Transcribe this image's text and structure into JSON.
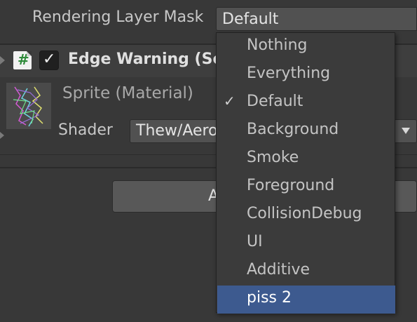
{
  "rendering_layer_mask": {
    "label": "Rendering Layer Mask",
    "value": "Default"
  },
  "component": {
    "title": "Edge Warning (Scr",
    "icon": "script-icon",
    "enabled": true
  },
  "material": {
    "name": "Sprite (Material)",
    "shader_label": "Shader",
    "shader_value": "Thew/Aero"
  },
  "add_button": {
    "label": "A"
  },
  "dropdown": {
    "items": [
      {
        "label": "Nothing",
        "checked": false,
        "highlighted": false
      },
      {
        "label": "Everything",
        "checked": false,
        "highlighted": false
      },
      {
        "label": "Default",
        "checked": true,
        "highlighted": false
      },
      {
        "label": "Background",
        "checked": false,
        "highlighted": false
      },
      {
        "label": "Smoke",
        "checked": false,
        "highlighted": false
      },
      {
        "label": "Foreground",
        "checked": false,
        "highlighted": false
      },
      {
        "label": "CollisionDebug",
        "checked": false,
        "highlighted": false
      },
      {
        "label": "UI",
        "checked": false,
        "highlighted": false
      },
      {
        "label": "Additive",
        "checked": false,
        "highlighted": false
      },
      {
        "label": "piss 2",
        "checked": false,
        "highlighted": true
      }
    ],
    "check_glyph": "✓",
    "highlight_color": "#3d5a8f"
  },
  "glyphs": {
    "script": "#",
    "checkbox": "✓"
  }
}
